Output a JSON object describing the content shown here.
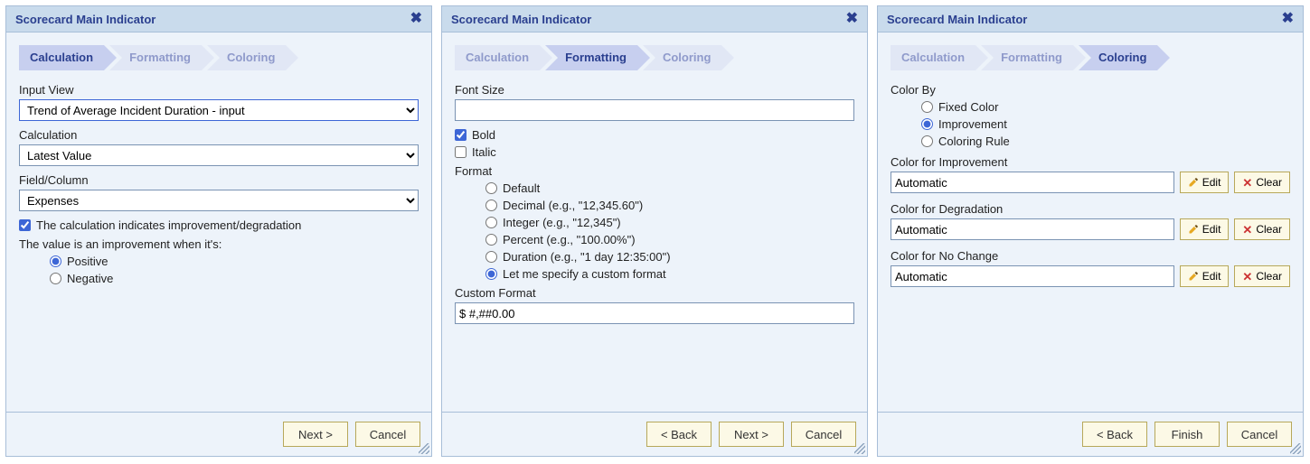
{
  "panels": [
    {
      "title": "Scorecard Main Indicator",
      "steps": [
        "Calculation",
        "Formatting",
        "Coloring"
      ],
      "activeStep": 0,
      "labels": {
        "inputView": "Input View",
        "calculation": "Calculation",
        "fieldColumn": "Field/Column",
        "indicates": "The calculation indicates improvement/degradation",
        "improvementWhen": "The value is an improvement when it's:",
        "positive": "Positive",
        "negative": "Negative"
      },
      "values": {
        "inputView": "Trend of Average Incident Duration - input",
        "calculation": "Latest Value",
        "fieldColumn": "Expenses",
        "indicatesChecked": true,
        "improvement": "positive"
      },
      "footer": {
        "next": "Next >",
        "cancel": "Cancel"
      }
    },
    {
      "title": "Scorecard Main Indicator",
      "steps": [
        "Calculation",
        "Formatting",
        "Coloring"
      ],
      "activeStep": 1,
      "labels": {
        "fontSize": "Font Size",
        "bold": "Bold",
        "italic": "Italic",
        "format": "Format",
        "fmtDefault": "Default",
        "fmtDecimal": "Decimal (e.g., \"12,345.60\")",
        "fmtInteger": "Integer (e.g., \"12,345\")",
        "fmtPercent": "Percent (e.g., \"100.00%\")",
        "fmtDuration": "Duration (e.g., \"1 day 12:35:00\")",
        "fmtCustom": "Let me specify a custom format",
        "customFormat": "Custom Format"
      },
      "values": {
        "fontSize": "",
        "bold": true,
        "italic": false,
        "format": "custom",
        "customFormat": "$ #,##0.00"
      },
      "footer": {
        "back": "< Back",
        "next": "Next >",
        "cancel": "Cancel"
      }
    },
    {
      "title": "Scorecard Main Indicator",
      "steps": [
        "Calculation",
        "Formatting",
        "Coloring"
      ],
      "activeStep": 2,
      "labels": {
        "colorBy": "Color By",
        "fixed": "Fixed Color",
        "improvement": "Improvement",
        "rule": "Coloring Rule",
        "colorImprove": "Color for Improvement",
        "colorDegrade": "Color for Degradation",
        "colorNoChange": "Color for No Change",
        "edit": "Edit",
        "clear": "Clear"
      },
      "values": {
        "colorBy": "improvement",
        "colorImprove": "Automatic",
        "colorDegrade": "Automatic",
        "colorNoChange": "Automatic"
      },
      "footer": {
        "back": "< Back",
        "finish": "Finish",
        "cancel": "Cancel"
      }
    }
  ]
}
